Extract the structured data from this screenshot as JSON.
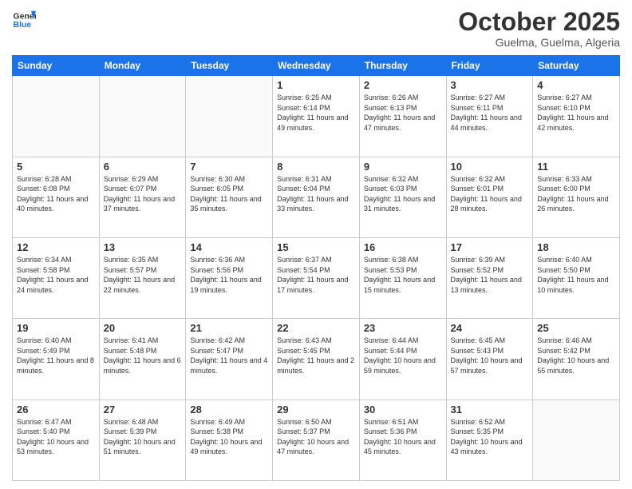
{
  "header": {
    "logo_line1": "General",
    "logo_line2": "Blue",
    "title": "October 2025",
    "subtitle": "Guelma, Guelma, Algeria"
  },
  "days_of_week": [
    "Sunday",
    "Monday",
    "Tuesday",
    "Wednesday",
    "Thursday",
    "Friday",
    "Saturday"
  ],
  "weeks": [
    [
      {
        "day": "",
        "empty": true
      },
      {
        "day": "",
        "empty": true
      },
      {
        "day": "",
        "empty": true
      },
      {
        "day": "1",
        "sunrise": "Sunrise: 6:25 AM",
        "sunset": "Sunset: 6:14 PM",
        "daylight": "Daylight: 11 hours and 49 minutes."
      },
      {
        "day": "2",
        "sunrise": "Sunrise: 6:26 AM",
        "sunset": "Sunset: 6:13 PM",
        "daylight": "Daylight: 11 hours and 47 minutes."
      },
      {
        "day": "3",
        "sunrise": "Sunrise: 6:27 AM",
        "sunset": "Sunset: 6:11 PM",
        "daylight": "Daylight: 11 hours and 44 minutes."
      },
      {
        "day": "4",
        "sunrise": "Sunrise: 6:27 AM",
        "sunset": "Sunset: 6:10 PM",
        "daylight": "Daylight: 11 hours and 42 minutes."
      }
    ],
    [
      {
        "day": "5",
        "sunrise": "Sunrise: 6:28 AM",
        "sunset": "Sunset: 6:08 PM",
        "daylight": "Daylight: 11 hours and 40 minutes."
      },
      {
        "day": "6",
        "sunrise": "Sunrise: 6:29 AM",
        "sunset": "Sunset: 6:07 PM",
        "daylight": "Daylight: 11 hours and 37 minutes."
      },
      {
        "day": "7",
        "sunrise": "Sunrise: 6:30 AM",
        "sunset": "Sunset: 6:05 PM",
        "daylight": "Daylight: 11 hours and 35 minutes."
      },
      {
        "day": "8",
        "sunrise": "Sunrise: 6:31 AM",
        "sunset": "Sunset: 6:04 PM",
        "daylight": "Daylight: 11 hours and 33 minutes."
      },
      {
        "day": "9",
        "sunrise": "Sunrise: 6:32 AM",
        "sunset": "Sunset: 6:03 PM",
        "daylight": "Daylight: 11 hours and 31 minutes."
      },
      {
        "day": "10",
        "sunrise": "Sunrise: 6:32 AM",
        "sunset": "Sunset: 6:01 PM",
        "daylight": "Daylight: 11 hours and 28 minutes."
      },
      {
        "day": "11",
        "sunrise": "Sunrise: 6:33 AM",
        "sunset": "Sunset: 6:00 PM",
        "daylight": "Daylight: 11 hours and 26 minutes."
      }
    ],
    [
      {
        "day": "12",
        "sunrise": "Sunrise: 6:34 AM",
        "sunset": "Sunset: 5:58 PM",
        "daylight": "Daylight: 11 hours and 24 minutes."
      },
      {
        "day": "13",
        "sunrise": "Sunrise: 6:35 AM",
        "sunset": "Sunset: 5:57 PM",
        "daylight": "Daylight: 11 hours and 22 minutes."
      },
      {
        "day": "14",
        "sunrise": "Sunrise: 6:36 AM",
        "sunset": "Sunset: 5:56 PM",
        "daylight": "Daylight: 11 hours and 19 minutes."
      },
      {
        "day": "15",
        "sunrise": "Sunrise: 6:37 AM",
        "sunset": "Sunset: 5:54 PM",
        "daylight": "Daylight: 11 hours and 17 minutes."
      },
      {
        "day": "16",
        "sunrise": "Sunrise: 6:38 AM",
        "sunset": "Sunset: 5:53 PM",
        "daylight": "Daylight: 11 hours and 15 minutes."
      },
      {
        "day": "17",
        "sunrise": "Sunrise: 6:39 AM",
        "sunset": "Sunset: 5:52 PM",
        "daylight": "Daylight: 11 hours and 13 minutes."
      },
      {
        "day": "18",
        "sunrise": "Sunrise: 6:40 AM",
        "sunset": "Sunset: 5:50 PM",
        "daylight": "Daylight: 11 hours and 10 minutes."
      }
    ],
    [
      {
        "day": "19",
        "sunrise": "Sunrise: 6:40 AM",
        "sunset": "Sunset: 5:49 PM",
        "daylight": "Daylight: 11 hours and 8 minutes."
      },
      {
        "day": "20",
        "sunrise": "Sunrise: 6:41 AM",
        "sunset": "Sunset: 5:48 PM",
        "daylight": "Daylight: 11 hours and 6 minutes."
      },
      {
        "day": "21",
        "sunrise": "Sunrise: 6:42 AM",
        "sunset": "Sunset: 5:47 PM",
        "daylight": "Daylight: 11 hours and 4 minutes."
      },
      {
        "day": "22",
        "sunrise": "Sunrise: 6:43 AM",
        "sunset": "Sunset: 5:45 PM",
        "daylight": "Daylight: 11 hours and 2 minutes."
      },
      {
        "day": "23",
        "sunrise": "Sunrise: 6:44 AM",
        "sunset": "Sunset: 5:44 PM",
        "daylight": "Daylight: 10 hours and 59 minutes."
      },
      {
        "day": "24",
        "sunrise": "Sunrise: 6:45 AM",
        "sunset": "Sunset: 5:43 PM",
        "daylight": "Daylight: 10 hours and 57 minutes."
      },
      {
        "day": "25",
        "sunrise": "Sunrise: 6:46 AM",
        "sunset": "Sunset: 5:42 PM",
        "daylight": "Daylight: 10 hours and 55 minutes."
      }
    ],
    [
      {
        "day": "26",
        "sunrise": "Sunrise: 6:47 AM",
        "sunset": "Sunset: 5:40 PM",
        "daylight": "Daylight: 10 hours and 53 minutes."
      },
      {
        "day": "27",
        "sunrise": "Sunrise: 6:48 AM",
        "sunset": "Sunset: 5:39 PM",
        "daylight": "Daylight: 10 hours and 51 minutes."
      },
      {
        "day": "28",
        "sunrise": "Sunrise: 6:49 AM",
        "sunset": "Sunset: 5:38 PM",
        "daylight": "Daylight: 10 hours and 49 minutes."
      },
      {
        "day": "29",
        "sunrise": "Sunrise: 6:50 AM",
        "sunset": "Sunset: 5:37 PM",
        "daylight": "Daylight: 10 hours and 47 minutes."
      },
      {
        "day": "30",
        "sunrise": "Sunrise: 6:51 AM",
        "sunset": "Sunset: 5:36 PM",
        "daylight": "Daylight: 10 hours and 45 minutes."
      },
      {
        "day": "31",
        "sunrise": "Sunrise: 6:52 AM",
        "sunset": "Sunset: 5:35 PM",
        "daylight": "Daylight: 10 hours and 43 minutes."
      },
      {
        "day": "",
        "empty": true
      }
    ]
  ]
}
